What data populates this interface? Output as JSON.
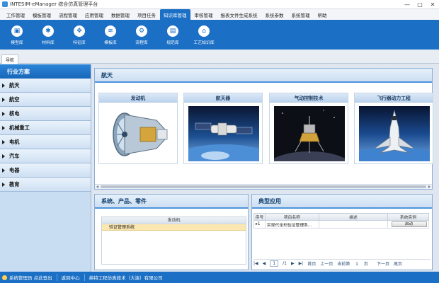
{
  "window": {
    "title": "INTESIM-eManager 综合仿真管理平台",
    "controls": [
      "—",
      "□",
      "✕"
    ]
  },
  "menu": [
    {
      "label": "工作管理",
      "active": false
    },
    {
      "label": "模板管理",
      "active": false
    },
    {
      "label": "流程管理",
      "active": false
    },
    {
      "label": "应用管理",
      "active": false
    },
    {
      "label": "数据管理",
      "active": false
    },
    {
      "label": "项目任务",
      "active": false
    },
    {
      "label": "知识库管理",
      "active": true
    },
    {
      "label": "审核管理",
      "active": false
    },
    {
      "label": "报表文件生成系统",
      "active": false
    },
    {
      "label": "系统参数",
      "active": false
    },
    {
      "label": "系统管理",
      "active": false
    },
    {
      "label": "帮助",
      "active": false
    }
  ],
  "toolbar": [
    {
      "label": "模型库",
      "icon": "model-library-icon",
      "glyph": "▣"
    },
    {
      "label": "材料库",
      "icon": "material-library-icon",
      "glyph": "✱"
    },
    {
      "label": "特征库",
      "icon": "feature-library-icon",
      "glyph": "✥"
    },
    {
      "label": "模板库",
      "icon": "template-library-icon",
      "glyph": "≋"
    },
    {
      "label": "流程库",
      "icon": "process-library-icon",
      "glyph": "⚙"
    },
    {
      "label": "规范库",
      "icon": "standard-library-icon",
      "glyph": "▤"
    },
    {
      "label": "工艺知识库",
      "icon": "craft-knowledge-icon",
      "glyph": "⌂"
    }
  ],
  "tabs": {
    "nav_label": "导航"
  },
  "sidebar": {
    "header": "行业方案",
    "items": [
      {
        "label": "航天"
      },
      {
        "label": "航空"
      },
      {
        "label": "核电"
      },
      {
        "label": "机械重工"
      },
      {
        "label": "电机"
      },
      {
        "label": "汽车"
      },
      {
        "label": "电器"
      },
      {
        "label": "教育"
      }
    ]
  },
  "aerospace_panel": {
    "title": "航天",
    "cards": [
      {
        "title": "发动机",
        "image": "jet-engine-image"
      },
      {
        "title": "航天器",
        "image": "spacecraft-image"
      },
      {
        "title": "气动控制技术",
        "image": "lander-image"
      },
      {
        "title": "飞行器动力工程",
        "image": "shuttle-image"
      }
    ]
  },
  "system_panel": {
    "title": "系统、产品、零件",
    "tree_header": "发动机",
    "tree_rows": [
      "验证管理系统"
    ]
  },
  "app_panel": {
    "title": "典型应用",
    "columns": [
      "序号",
      "项目名称",
      "描述",
      "系统实例"
    ],
    "rows": [
      {
        "index": "1",
        "name": "实现代全形验证管理系...",
        "desc": "",
        "action": "启动"
      }
    ],
    "pager": {
      "first": "|◀",
      "prev": "◀",
      "page": "1",
      "of": "/1",
      "next": "▶",
      "last": "▶|",
      "home": "首页",
      "prev_text": "上一页",
      "current": "当前第",
      "current_page": "1",
      "page_unit": "页",
      "next_text": "下一页",
      "end": "尾页"
    }
  },
  "statusbar": {
    "user": "系统管理员 点此登出",
    "home": "返回中心",
    "company": "英特工程仿真技术（大连）有限公司"
  }
}
